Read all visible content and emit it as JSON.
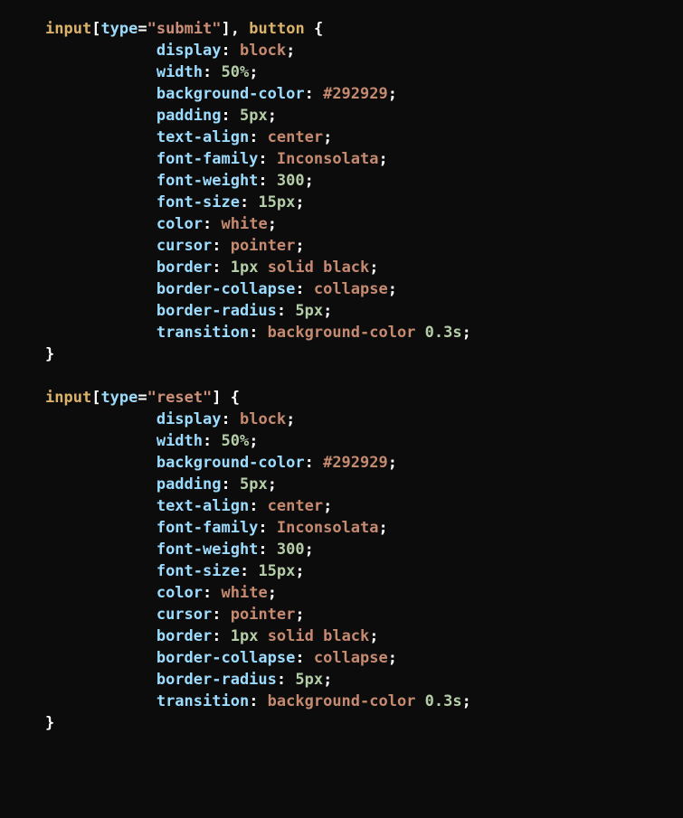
{
  "code": {
    "rule1": {
      "selector_tag1": "input",
      "selector_attr_name": "type",
      "selector_attr_eq": "=",
      "selector_attr_val": "\"submit\"",
      "selector_close_bracket": "]",
      "selector_comma": ", ",
      "selector_tag2": "button",
      "space_open": " ",
      "brace_open": "{",
      "decls": {
        "d0_p": "display",
        "d0_c": ": ",
        "d0_v": "block",
        "d0_s": ";",
        "d1_p": "width",
        "d1_c": ": ",
        "d1_n": "50%",
        "d1_s": ";",
        "d2_p": "background-color",
        "d2_c": ": ",
        "d2_v": "#292929",
        "d2_s": ";",
        "d3_p": "padding",
        "d3_c": ": ",
        "d3_n": "5px",
        "d3_s": ";",
        "d4_p": "text-align",
        "d4_c": ": ",
        "d4_v": "center",
        "d4_s": ";",
        "d5_p": "font-family",
        "d5_c": ": ",
        "d5_v": "Inconsolata",
        "d5_s": ";",
        "d6_p": "font-weight",
        "d6_c": ": ",
        "d6_n": "300",
        "d6_s": ";",
        "d7_p": "font-size",
        "d7_c": ": ",
        "d7_n": "15px",
        "d7_s": ";",
        "d8_p": "color",
        "d8_c": ": ",
        "d8_v": "white",
        "d8_s": ";",
        "d9_p": "cursor",
        "d9_c": ": ",
        "d9_v": "pointer",
        "d9_s": ";",
        "d10_p": "border",
        "d10_c": ": ",
        "d10_n": "1px ",
        "d10_v": "solid black",
        "d10_s": ";",
        "d11_p": "border-collapse",
        "d11_c": ": ",
        "d11_v": "collapse",
        "d11_s": ";",
        "d12_p": "border-radius",
        "d12_c": ": ",
        "d12_n": "5px",
        "d12_s": ";",
        "d13_p": "transition",
        "d13_c": ": ",
        "d13_v": "background-color ",
        "d13_n": "0.3s",
        "d13_s": ";"
      },
      "brace_close": "}"
    },
    "rule2": {
      "selector_tag1": "input",
      "selector_attr_name": "type",
      "selector_attr_eq": "=",
      "selector_attr_val": "\"reset\"",
      "selector_close_bracket": "]",
      "space_open": " ",
      "brace_open": "{",
      "decls": {
        "d0_p": "display",
        "d0_c": ": ",
        "d0_v": "block",
        "d0_s": ";",
        "d1_p": "width",
        "d1_c": ": ",
        "d1_n": "50%",
        "d1_s": ";",
        "d2_p": "background-color",
        "d2_c": ": ",
        "d2_v": "#292929",
        "d2_s": ";",
        "d3_p": "padding",
        "d3_c": ": ",
        "d3_n": "5px",
        "d3_s": ";",
        "d4_p": "text-align",
        "d4_c": ": ",
        "d4_v": "center",
        "d4_s": ";",
        "d5_p": "font-family",
        "d5_c": ": ",
        "d5_v": "Inconsolata",
        "d5_s": ";",
        "d6_p": "font-weight",
        "d6_c": ": ",
        "d6_n": "300",
        "d6_s": ";",
        "d7_p": "font-size",
        "d7_c": ": ",
        "d7_n": "15px",
        "d7_s": ";",
        "d8_p": "color",
        "d8_c": ": ",
        "d8_v": "white",
        "d8_s": ";",
        "d9_p": "cursor",
        "d9_c": ": ",
        "d9_v": "pointer",
        "d9_s": ";",
        "d10_p": "border",
        "d10_c": ": ",
        "d10_n": "1px ",
        "d10_v": "solid black",
        "d10_s": ";",
        "d11_p": "border-collapse",
        "d11_c": ": ",
        "d11_v": "collapse",
        "d11_s": ";",
        "d12_p": "border-radius",
        "d12_c": ": ",
        "d12_n": "5px",
        "d12_s": ";",
        "d13_p": "transition",
        "d13_c": ": ",
        "d13_v": "background-color ",
        "d13_n": "0.3s",
        "d13_s": ";"
      },
      "brace_close": "}"
    }
  }
}
